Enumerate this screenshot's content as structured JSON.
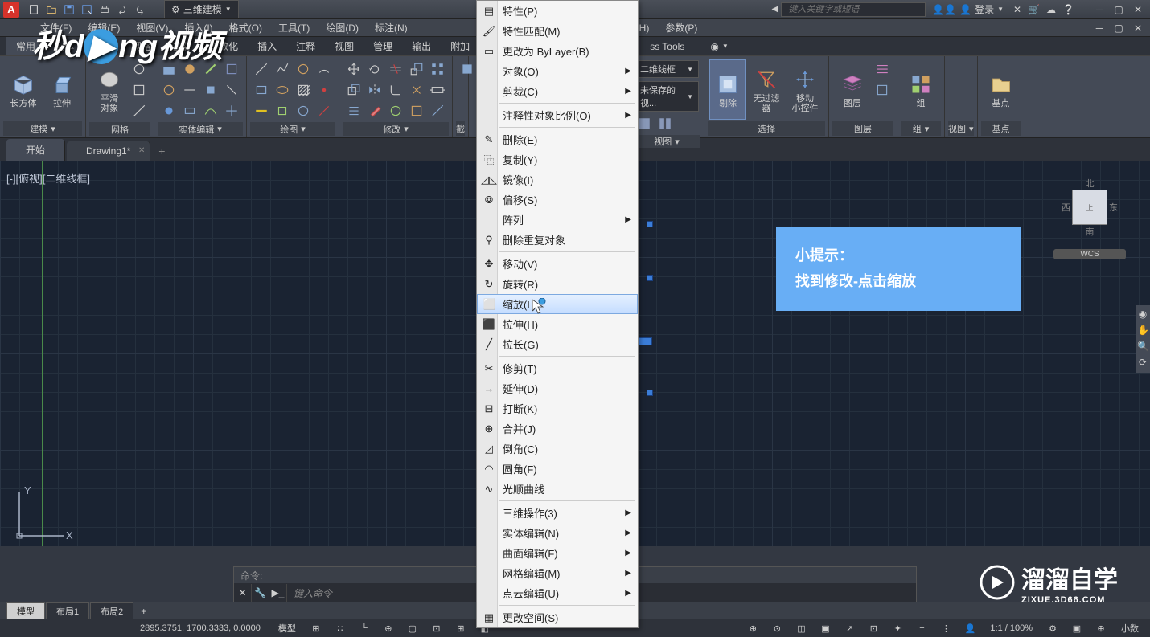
{
  "title": {
    "app_prefix": "Autodesk",
    "workspace": "三维建模",
    "search_placeholder": "键入关键字或短语",
    "login": "登录"
  },
  "menu": {
    "file": "文件(F)",
    "edit": "编辑(E)",
    "view": "视图(V)",
    "insert": "插入(I)",
    "format": "格式(O)",
    "tools": "工具(T)",
    "draw": "绘图(D)",
    "dimension": "标注(N)",
    "help": "帮助(H)",
    "parametric": "参数(P)"
  },
  "ribbon_tabs": {
    "home": "常用",
    "parametric": "参数化",
    "insert": "插入",
    "annotate": "注释",
    "view": "视图",
    "manage": "管理",
    "output": "输出",
    "addins": "附加",
    "express": "ss Tools"
  },
  "ribbon": {
    "modeling": {
      "label": "建模",
      "box": "长方体",
      "extrude": "拉伸",
      "smooth": "平滑\n对象"
    },
    "mesh": {
      "label": "网格"
    },
    "solid_edit": {
      "label": "实体编辑"
    },
    "draw": {
      "label": "绘图"
    },
    "modify": {
      "label": "修改"
    },
    "view": {
      "label": "视图",
      "visual_style": "二维线框",
      "view_preset": "未保存的视..."
    },
    "selection": {
      "label": "选择",
      "subtract": "剔除",
      "nofilter": "无过滤器",
      "move_gizmo": "移动\n小控件"
    },
    "layers": {
      "label": "图层",
      "btn": "图层"
    },
    "view2": {
      "label": "视图"
    },
    "groups": {
      "label": "组",
      "btn": "组"
    },
    "base": {
      "label": "基点",
      "btn": "基点"
    }
  },
  "doc_tabs": {
    "start": "开始",
    "drawing": "Drawing1*"
  },
  "viewport": {
    "label": "[-][俯视][二维线框]",
    "wcs": "WCS",
    "north": "北",
    "south": "南",
    "east": "东",
    "west": "西"
  },
  "hint": {
    "title": "小提示：",
    "body": "找到修改-点击缩放"
  },
  "context_menu": {
    "properties": "特性(P)",
    "match_props": "特性匹配(M)",
    "change_bylayer": "更改为 ByLayer(B)",
    "object": "对象(O)",
    "crop": "剪裁(C)",
    "annot_scale": "注释性对象比例(O)",
    "erase": "删除(E)",
    "copy": "复制(Y)",
    "mirror": "镜像(I)",
    "offset": "偏移(S)",
    "array": "阵列",
    "delete_dup": "删除重复对象",
    "move": "移动(V)",
    "rotate": "旋转(R)",
    "scale": "缩放(L)",
    "stretch": "拉伸(H)",
    "lengthen": "拉长(G)",
    "trim": "修剪(T)",
    "extend": "延伸(D)",
    "break": "打断(K)",
    "join": "合并(J)",
    "chamfer": "倒角(C)",
    "fillet": "圆角(F)",
    "blend": "光顺曲线",
    "three_d": "三维操作(3)",
    "solid_edit": "实体编辑(N)",
    "surface_edit": "曲面编辑(F)",
    "mesh_edit": "网格编辑(M)",
    "point_cloud": "点云编辑(U)",
    "change_space": "更改空间(S)"
  },
  "cmd": {
    "history": "命令:",
    "placeholder": "键入命令"
  },
  "layout_tabs": {
    "model": "模型",
    "layout1": "布局1",
    "layout2": "布局2"
  },
  "status": {
    "coords": "2895.3751, 1700.3333, 0.0000",
    "model": "模型",
    "scale": "1:1 / 100%",
    "decimal": "小数"
  },
  "logo": {
    "md": "秒dong视频",
    "zx": "溜溜自学",
    "zx_url": "ZIXUE.3D66.COM"
  }
}
